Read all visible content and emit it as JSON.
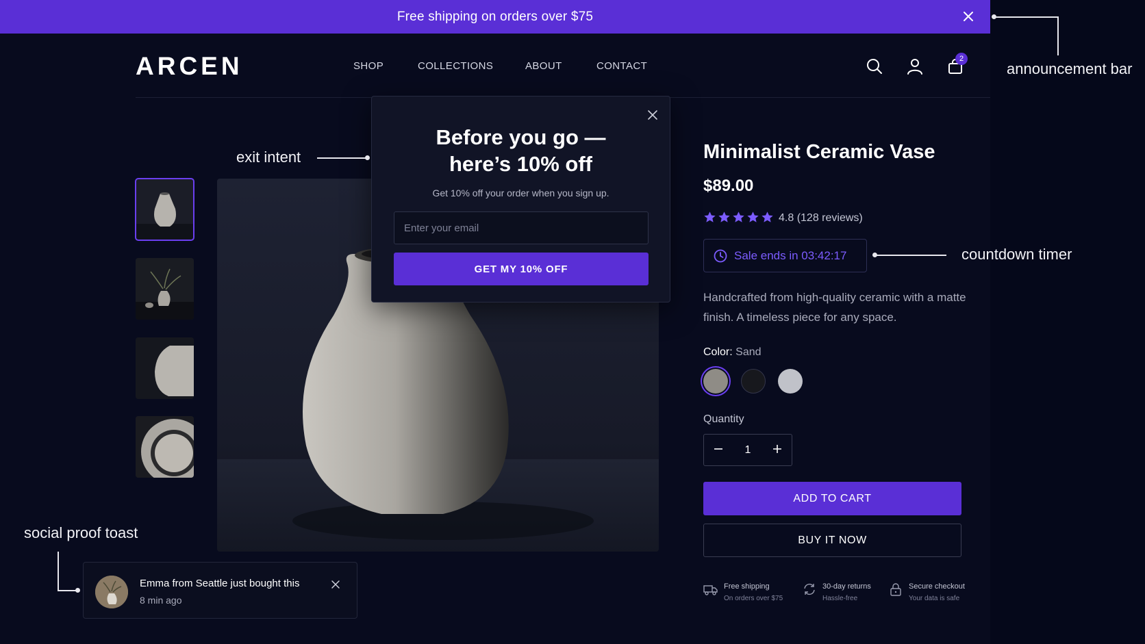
{
  "announcement": {
    "text": "Free shipping on orders over $75"
  },
  "header": {
    "logo": "ARCEN",
    "nav": [
      "SHOP",
      "COLLECTIONS",
      "ABOUT",
      "CONTACT"
    ],
    "icons": [
      "search-icon",
      "account-icon",
      "cart-icon"
    ],
    "cart_count": "2"
  },
  "product": {
    "title": "Minimalist Ceramic Vase",
    "price": "$89.00",
    "rating_stars": 5,
    "rating_text": "4.8 (128 reviews)",
    "countdown": "Sale ends in 03:42:17",
    "description": "Handcrafted from high-quality ceramic with a matte finish. A timeless piece for any space.",
    "color_label": "Color:",
    "color_value": "Sand",
    "swatches": [
      "#8f8c86",
      "#17181d",
      "#c0c2c9"
    ],
    "quantity_label": "Quantity",
    "quantity": "1",
    "add_to_cart": "ADD TO CART",
    "buy_now": "BUY IT NOW",
    "features": [
      {
        "title": "Free shipping",
        "sub": "On orders over $75",
        "icon": "truck-icon"
      },
      {
        "title": "30-day returns",
        "sub": "Hassle-free",
        "icon": "refresh-icon"
      },
      {
        "title": "Secure checkout",
        "sub": "Your data is safe",
        "icon": "lock-icon"
      }
    ]
  },
  "popup": {
    "title_line1": "Before you go —",
    "title_line2": "here’s 10% off",
    "subtitle": "Get 10% off your order when you sign up.",
    "email_placeholder": "Enter your email",
    "button": "GET MY 10% OFF"
  },
  "toast": {
    "message": "Emma from Seattle just bought this",
    "time": "8 min ago"
  },
  "annotations": {
    "announcement_bar": "announcement bar",
    "exit_intent": "exit intent",
    "countdown_timer": "countdown timer",
    "social_proof_toast": "social proof toast"
  },
  "colors": {
    "accent": "#5a2fd6",
    "accent_text": "#7c5cff",
    "background": "#080b1e"
  }
}
